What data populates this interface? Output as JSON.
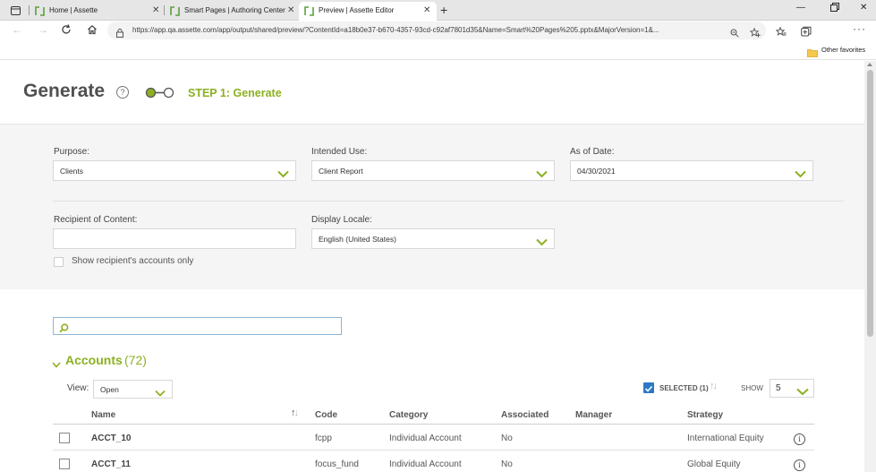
{
  "browser": {
    "tabs": [
      {
        "title": "Home | Assette"
      },
      {
        "title": "Smart Pages | Authoring Center"
      },
      {
        "title": "Preview | Assette Editor"
      }
    ],
    "url": "https://app.qa.assette.com/app/output/shared/preview/?ContentId=a18b0e37-b670-4357-93cd-c92af7801d35&Name=Smart%20Pages%205.pptx&MajorVersion=1&...",
    "favorites_folder": "Other favorites"
  },
  "header": {
    "title": "Generate",
    "help": "?",
    "step_label": "STEP 1: Generate"
  },
  "form": {
    "purpose_label": "Purpose:",
    "purpose_value": "Clients",
    "intended_use_label": "Intended Use:",
    "intended_use_value": "Client Report",
    "as_of_date_label": "As of Date:",
    "as_of_date_value": "04/30/2021",
    "recipient_label": "Recipient of Content:",
    "recipient_value": "",
    "locale_label": "Display Locale:",
    "locale_value": "English (United States)",
    "show_recipient_accounts_label": "Show recipient's accounts only"
  },
  "accounts": {
    "title": "Accounts",
    "count": "(72)",
    "view_label": "View:",
    "view_value": "Open",
    "selected_label": "SELECTED (1)",
    "show_label": "SHOW",
    "show_value": "5",
    "columns": {
      "name": "Name",
      "code": "Code",
      "category": "Category",
      "associated": "Associated",
      "manager": "Manager",
      "strategy": "Strategy"
    },
    "rows": [
      {
        "name": "ACCT_10",
        "code": "fcpp",
        "category": "Individual Account",
        "associated": "No",
        "manager": "",
        "strategy": "International Equity"
      },
      {
        "name": "ACCT_11",
        "code": "focus_fund",
        "category": "Individual Account",
        "associated": "No",
        "manager": "",
        "strategy": "Global Equity"
      }
    ]
  },
  "colors": {
    "brand_green": "#8cb021",
    "checkbox_blue": "#2b79c5",
    "panel_gray": "#f5f5f5"
  }
}
